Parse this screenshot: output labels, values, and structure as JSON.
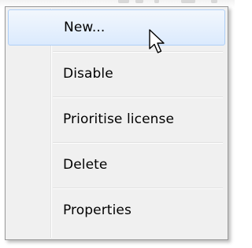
{
  "menu": {
    "items": [
      {
        "label": "New...",
        "highlighted": true
      },
      {
        "label": "Disable",
        "highlighted": false
      },
      {
        "label": "Prioritise license",
        "highlighted": false
      },
      {
        "label": "Delete",
        "highlighted": false
      },
      {
        "label": "Properties",
        "highlighted": false
      }
    ]
  },
  "colors": {
    "menu_background": "#f0f0f0",
    "menu_border": "#979797",
    "highlight_border": "#aecff7",
    "highlight_fill_top": "#f2f7fd",
    "highlight_fill_bottom": "#dbeafd",
    "text": "#000000"
  },
  "cursor": {
    "icon": "arrow-pointer-icon"
  }
}
